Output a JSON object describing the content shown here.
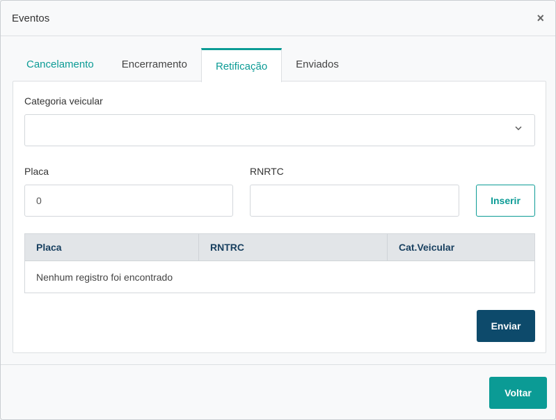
{
  "modal": {
    "title": "Eventos",
    "close_glyph": "×"
  },
  "tabs": [
    {
      "label": "Cancelamento"
    },
    {
      "label": "Encerramento"
    },
    {
      "label": "Retificação"
    },
    {
      "label": "Enviados"
    }
  ],
  "form": {
    "categoria_label": "Categoria veicular",
    "categoria_value": "",
    "placa_label": "Placa",
    "placa_value": "0",
    "rnrtc_label": "RNRTC",
    "rnrtc_value": "",
    "inserir_label": "Inserir"
  },
  "table": {
    "headers": [
      "Placa",
      "RNTRC",
      "Cat.Veicular"
    ],
    "empty_message": "Nenhum registro foi encontrado"
  },
  "actions": {
    "enviar_label": "Enviar",
    "voltar_label": "Voltar"
  },
  "colors": {
    "teal": "#0b9b95",
    "navy": "#0d4a6b",
    "header_text": "#173f5f"
  },
  "icons": {
    "close": "close-icon",
    "dropdown": "chevron-down-icon"
  }
}
